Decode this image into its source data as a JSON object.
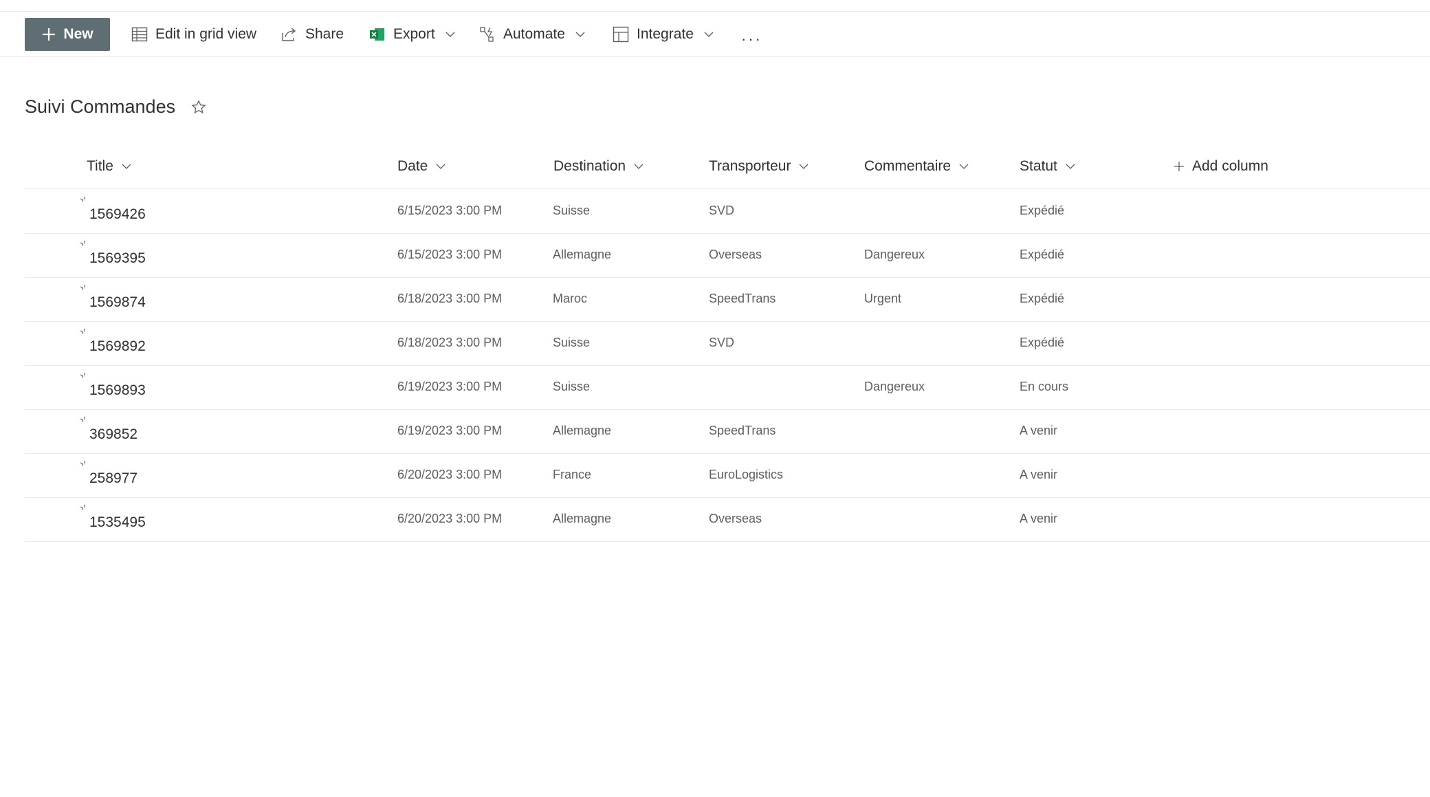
{
  "toolbar": {
    "new_label": "New",
    "edit_grid_label": "Edit in grid view",
    "share_label": "Share",
    "export_label": "Export",
    "automate_label": "Automate",
    "integrate_label": "Integrate",
    "more_label": "···"
  },
  "list": {
    "title": "Suivi Commandes",
    "columns": {
      "title": "Title",
      "date": "Date",
      "destination": "Destination",
      "transporteur": "Transporteur",
      "commentaire": "Commentaire",
      "statut": "Statut",
      "add_column": "Add column"
    },
    "rows": [
      {
        "title": "1569426",
        "date": "6/15/2023 3:00 PM",
        "destination": "Suisse",
        "transporteur": "SVD",
        "commentaire": "",
        "statut": "Expédié"
      },
      {
        "title": "1569395",
        "date": "6/15/2023 3:00 PM",
        "destination": "Allemagne",
        "transporteur": "Overseas",
        "commentaire": "Dangereux",
        "statut": "Expédié"
      },
      {
        "title": "1569874",
        "date": "6/18/2023 3:00 PM",
        "destination": "Maroc",
        "transporteur": "SpeedTrans",
        "commentaire": "Urgent",
        "statut": "Expédié"
      },
      {
        "title": "1569892",
        "date": "6/18/2023 3:00 PM",
        "destination": "Suisse",
        "transporteur": "SVD",
        "commentaire": "",
        "statut": "Expédié"
      },
      {
        "title": "1569893",
        "date": "6/19/2023 3:00 PM",
        "destination": "Suisse",
        "transporteur": "",
        "commentaire": "Dangereux",
        "statut": "En cours"
      },
      {
        "title": "369852",
        "date": "6/19/2023 3:00 PM",
        "destination": "Allemagne",
        "transporteur": "SpeedTrans",
        "commentaire": "",
        "statut": "A venir"
      },
      {
        "title": "258977",
        "date": "6/20/2023 3:00 PM",
        "destination": "France",
        "transporteur": "EuroLogistics",
        "commentaire": "",
        "statut": "A venir"
      },
      {
        "title": "1535495",
        "date": "6/20/2023 3:00 PM",
        "destination": "Allemagne",
        "transporteur": "Overseas",
        "commentaire": "",
        "statut": "A venir"
      }
    ]
  },
  "colors": {
    "new_button_bg": "#5f6e72",
    "excel_green": "#107c41"
  }
}
